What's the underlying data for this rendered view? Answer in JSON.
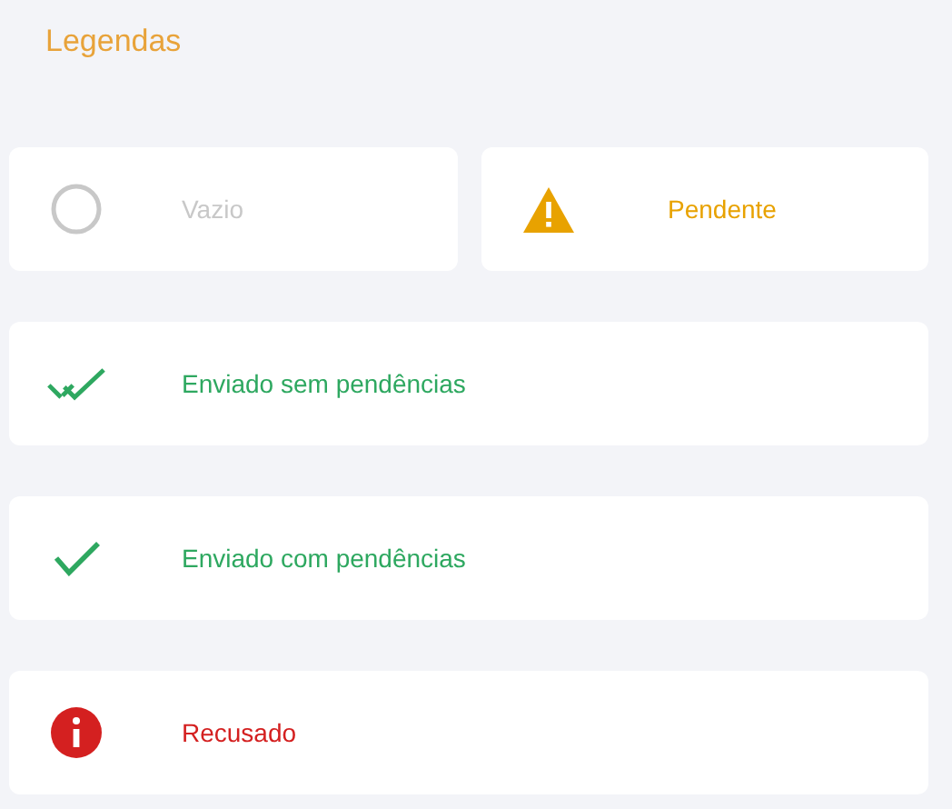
{
  "title": "Legendas",
  "rows": [
    [
      {
        "kind": "empty",
        "label": "Vazio",
        "color": "#c8c8c8"
      },
      {
        "kind": "warning",
        "label": "Pendente",
        "color": "#e8a200"
      }
    ],
    [
      {
        "kind": "double-check",
        "label": "Enviado sem pendências",
        "color": "#2ea860"
      }
    ],
    [
      {
        "kind": "check",
        "label": "Enviado com pendências",
        "color": "#2ea860"
      }
    ],
    [
      {
        "kind": "error",
        "label": "Recusado",
        "color": "#d42020"
      }
    ]
  ]
}
